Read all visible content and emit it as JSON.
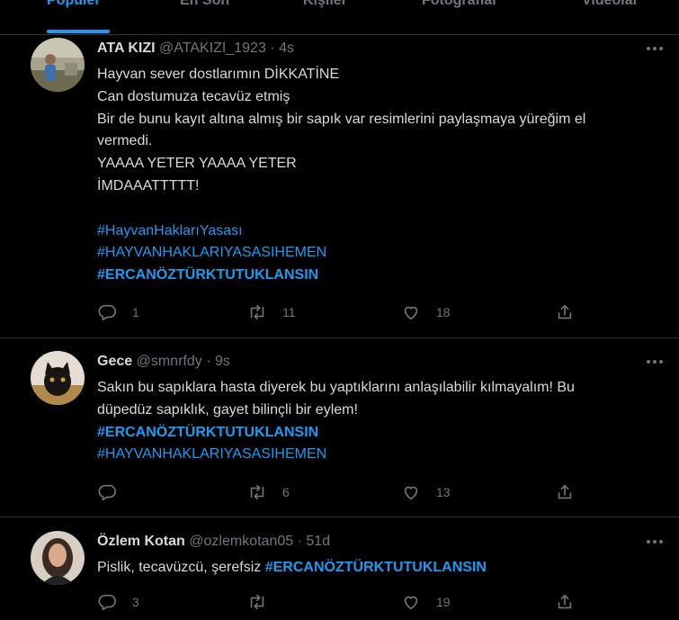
{
  "tabs": [
    {
      "label": "Popüler"
    },
    {
      "label": "En Son"
    },
    {
      "label": "Kişiler"
    },
    {
      "label": "Fotoğraflar"
    },
    {
      "label": "Videolar"
    }
  ],
  "tweets": [
    {
      "name": "ATA KIZI",
      "handle": "@ATAKIZI_1923",
      "separator": "·",
      "time": "4s",
      "lines": [
        "Hayvan sever dostlarımın DİKKATİNE",
        "Can dostumuza tecavüz etmiş",
        "Bir de bunu kayıt altına almış bir sapık var resimlerini paylaşmaya yüreğim  el",
        "vermedi.",
        "YAAAA YETER YAAAA YETER",
        "İMDAAATTTTT!"
      ],
      "hashtags": [
        "#HayvanHaklarıYasası",
        "#HAYVANHAKLARIYASASIHEMEN",
        "#ERCANÖZTÜRKTUTUKLANSIN"
      ],
      "replies": "1",
      "retweets": "11",
      "likes": "18"
    },
    {
      "name": "Gece",
      "handle": "@smnrfdy",
      "separator": "·",
      "time": "9s",
      "lines": [
        "Sakın bu sapıklara hasta diyerek bu yaptıklarını anlaşılabilir kılmayalım! Bu",
        "düpedüz sapıklık, gayet bilinçli bir eylem!"
      ],
      "hashtags": [
        "#ERCANÖZTÜRKTUTUKLANSIN",
        "#HAYVANHAKLARIYASASIHEMEN"
      ],
      "replies": "",
      "retweets": "6",
      "likes": "13"
    },
    {
      "name": "Özlem Kotan",
      "handle": "@ozlemkotan05",
      "separator": "·",
      "time": "51d",
      "text": "Pislik, tecavüzcü, şerefsiz ",
      "hashtag": "#ERCANÖZTÜRKTUTUKLANSIN",
      "replies": "3",
      "retweets": "",
      "likes": "19"
    }
  ],
  "icons": {
    "reply": "reply-icon",
    "retweet": "retweet-icon",
    "like": "heart-icon",
    "share": "share-icon",
    "more": "more-icon"
  },
  "colors": {
    "background": "#000000",
    "accent": "#1d9bf0",
    "text": "#d9d9d9",
    "muted": "#6e767d",
    "border": "#2f3336"
  }
}
